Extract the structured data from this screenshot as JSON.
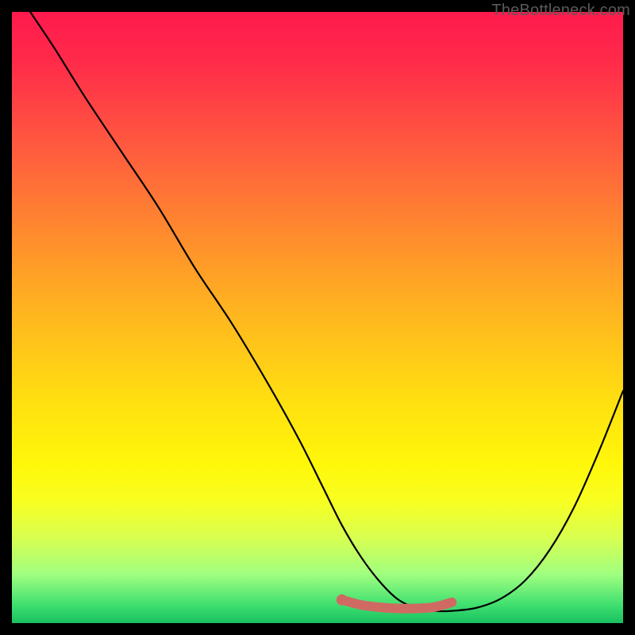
{
  "watermark": "TheBottleneck.com",
  "chart_data": {
    "type": "line",
    "title": "",
    "xlabel": "",
    "ylabel": "",
    "xlim": [
      0,
      100
    ],
    "ylim": [
      0,
      100
    ],
    "grid": false,
    "legend": false,
    "series": [
      {
        "name": "curve",
        "color": "#000000",
        "x": [
          3,
          7,
          12,
          18,
          24,
          30,
          36,
          42,
          47,
          51,
          54,
          57,
          60,
          63,
          66,
          69,
          72,
          76,
          80,
          84,
          88,
          92,
          96,
          100
        ],
        "y": [
          100,
          94,
          86,
          77,
          68,
          58,
          49,
          39,
          30,
          22,
          16,
          11,
          7,
          4,
          2.5,
          2,
          2,
          2.5,
          4,
          7,
          12,
          19,
          28,
          38
        ]
      },
      {
        "name": "highlight",
        "color": "#cf6a63",
        "x": [
          54,
          57,
          60,
          63,
          66,
          69,
          72
        ],
        "y": [
          3.8,
          3.0,
          2.6,
          2.4,
          2.4,
          2.6,
          3.4
        ]
      }
    ],
    "annotations": []
  }
}
